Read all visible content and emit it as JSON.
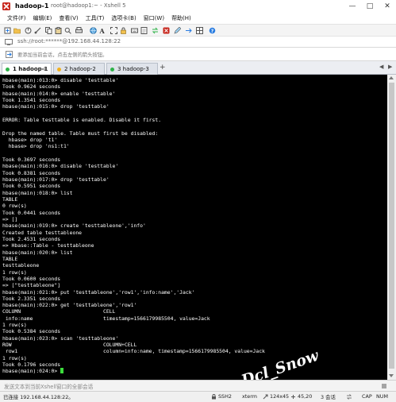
{
  "window": {
    "title": "hadoop-1",
    "subtitle": "root@hadoop1:~ - Xshell 5",
    "minimize": "—",
    "maximize": "□",
    "close": "✕"
  },
  "menu": [
    "文件(F)",
    "编辑(E)",
    "查看(V)",
    "工具(T)",
    "选项卡(B)",
    "窗口(W)",
    "帮助(H)"
  ],
  "address": {
    "value": "ssh://root:******@192.168.44.128:22"
  },
  "hint": {
    "text": "要添加当前会话，点击左侧的箭头按钮。"
  },
  "tabs": [
    {
      "label": "1 hadoop-1",
      "color": "#2fb34a"
    },
    {
      "label": "2 hadoop-2",
      "color": "#f2b01e"
    },
    {
      "label": "3 hadoop-3",
      "color": "#2fb34a"
    }
  ],
  "tab_close": "×",
  "tab_add": "+",
  "tab_prev": "◀",
  "tab_next": "▶",
  "terminal": {
    "lines": [
      "hbase(main):013:0> disable 'testtable'",
      "Took 0.9624 seconds",
      "hbase(main):014:0> enable 'testtable'",
      "Took 1.3541 seconds",
      "hbase(main):015:0> drop 'testtable'",
      "",
      "ERROR: Table testtable is enabled. Disable it first.",
      "",
      "Drop the named table. Table must first be disabled:",
      "  hbase> drop 't1'",
      "  hbase> drop 'ns1:t1'",
      "",
      "Took 0.3697 seconds",
      "hbase(main):016:0> disable 'testtable'",
      "Took 0.8381 seconds",
      "hbase(main):017:0> drop 'testtable'",
      "Took 0.5951 seconds",
      "hbase(main):018:0> list",
      "TABLE",
      "0 row(s)",
      "Took 0.0441 seconds",
      "=> []",
      "hbase(main):019:0> create 'testtableone','info'",
      "Created table testtableone",
      "Took 2.4531 seconds",
      "=> Hbase::Table - testtableone",
      "hbase(main):020:0> list",
      "TABLE",
      "testtableone",
      "1 row(s)",
      "Took 0.0600 seconds",
      "=> [\"testtableone\"]",
      "hbase(main):021:0> put 'testtableone','row1','info:name','Jack'",
      "Took 2.3351 seconds",
      "hbase(main):022:0> get 'testtableone','row1'",
      "COLUMN                           CELL",
      " info:name                       timestamp=1566179985504, value=Jack",
      "1 row(s)",
      "Took 0.5384 seconds",
      "hbase(main):023:0> scan 'testtableone'",
      "ROW                              COLUMN+CELL",
      " row1                            column=info:name, timestamp=1566179985504, value=Jack",
      "1 row(s)",
      "Took 0.1796 seconds"
    ],
    "prompt": "hbase(main):024:0> ",
    "watermark": "Dcl_Snow"
  },
  "input": {
    "placeholder": "发送文本到当前Xshell窗口的全部会话"
  },
  "status": {
    "connection": "已连接 192.168.44.128:22。",
    "protocol": "SSH2",
    "term": "xterm",
    "size": "124x45",
    "cursor_pos": "45,20",
    "sessions": "3 会话",
    "caps": "CAP",
    "num": "NUM"
  },
  "colors": {
    "terminal_bg": "#000000",
    "terminal_fg": "#ffffff",
    "cursor": "#3cdc3c"
  }
}
